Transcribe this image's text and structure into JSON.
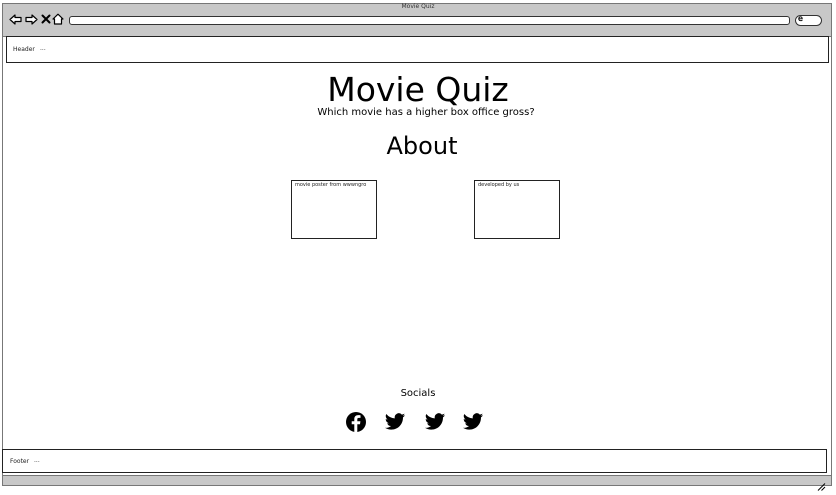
{
  "window": {
    "title": "Movie Quiz"
  },
  "header": {
    "label": "Header",
    "extra": "..."
  },
  "main": {
    "title": "Movie Quiz",
    "subtitle": "Which movie has a higher box office gross?",
    "about_heading": "About",
    "cards": [
      {
        "text": "movie poster from wwwngro"
      },
      {
        "text": "developed by us"
      }
    ]
  },
  "socials": {
    "heading": "Socials",
    "icons": [
      "facebook-icon",
      "twitter-icon",
      "twitter-icon",
      "twitter-icon"
    ]
  },
  "footer": {
    "label": "Footer",
    "extra": "..."
  }
}
